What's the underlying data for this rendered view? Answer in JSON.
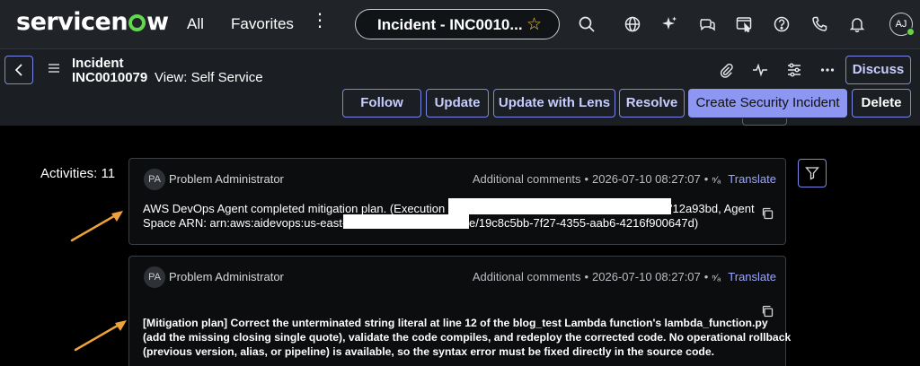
{
  "brand": {
    "logo_text_pre": "servicen",
    "logo_text_post": "w"
  },
  "topnav": {
    "all_label": "All",
    "favorites_label": "Favorites",
    "context_title": "Incident - INC0010...",
    "avatar_initials": "AJ"
  },
  "record": {
    "table": "Incident",
    "number": "INC0010079",
    "view": "View: Self Service"
  },
  "actions": {
    "discuss": "Discuss",
    "follow": "Follow",
    "update": "Update",
    "update_with_lens": "Update with Lens",
    "resolve": "Resolve",
    "create_security_incident": "Create Security Incident",
    "delete": "Delete"
  },
  "activities": {
    "label": "Activities: 11",
    "entries": [
      {
        "initials": "PA",
        "author": "Problem Administrator",
        "type": "Additional comments",
        "timestamp": "2026-07-10 08:27:07",
        "translate": "Translate",
        "line1_start": "AWS DevOps Agent completed mitigation plan. (Execution ID:",
        "line1_end": "'12a93bd, Agent",
        "line2_start": "Space ARN: arn:aws:aidevops:us-east-1",
        "line2_end": "e/19c8c5bb-7f27-4355-aab6-4216f900647d)"
      },
      {
        "initials": "PA",
        "author": "Problem Administrator",
        "type": "Additional comments",
        "timestamp": "2026-07-10 08:27:07",
        "translate": "Translate",
        "lines": [
          "[Mitigation plan] Correct the unterminated string literal at line 12 of the blog_test Lambda function's lambda_function.py",
          "(add the missing closing single quote), validate the code compiles, and redeploy the corrected code. No operational rollback",
          "(previous version, alias, or pipeline) is available, so the syntax error must be fixed directly in the source code."
        ]
      }
    ]
  },
  "colors": {
    "accent": "#7b86e9",
    "primary_button": "#8d97f2",
    "annotation_arrow": "#f0a23a",
    "logo_green": "#62d84e"
  },
  "icons": [
    "search-icon",
    "globe-icon",
    "sparkle-icon",
    "chat-icon",
    "screen-icon",
    "help-icon",
    "phone-icon",
    "bell-icon",
    "paperclip-icon",
    "pulse-icon",
    "sliders-icon",
    "more-icon",
    "filter-icon",
    "copy-icon",
    "translate-icon",
    "star-icon"
  ]
}
